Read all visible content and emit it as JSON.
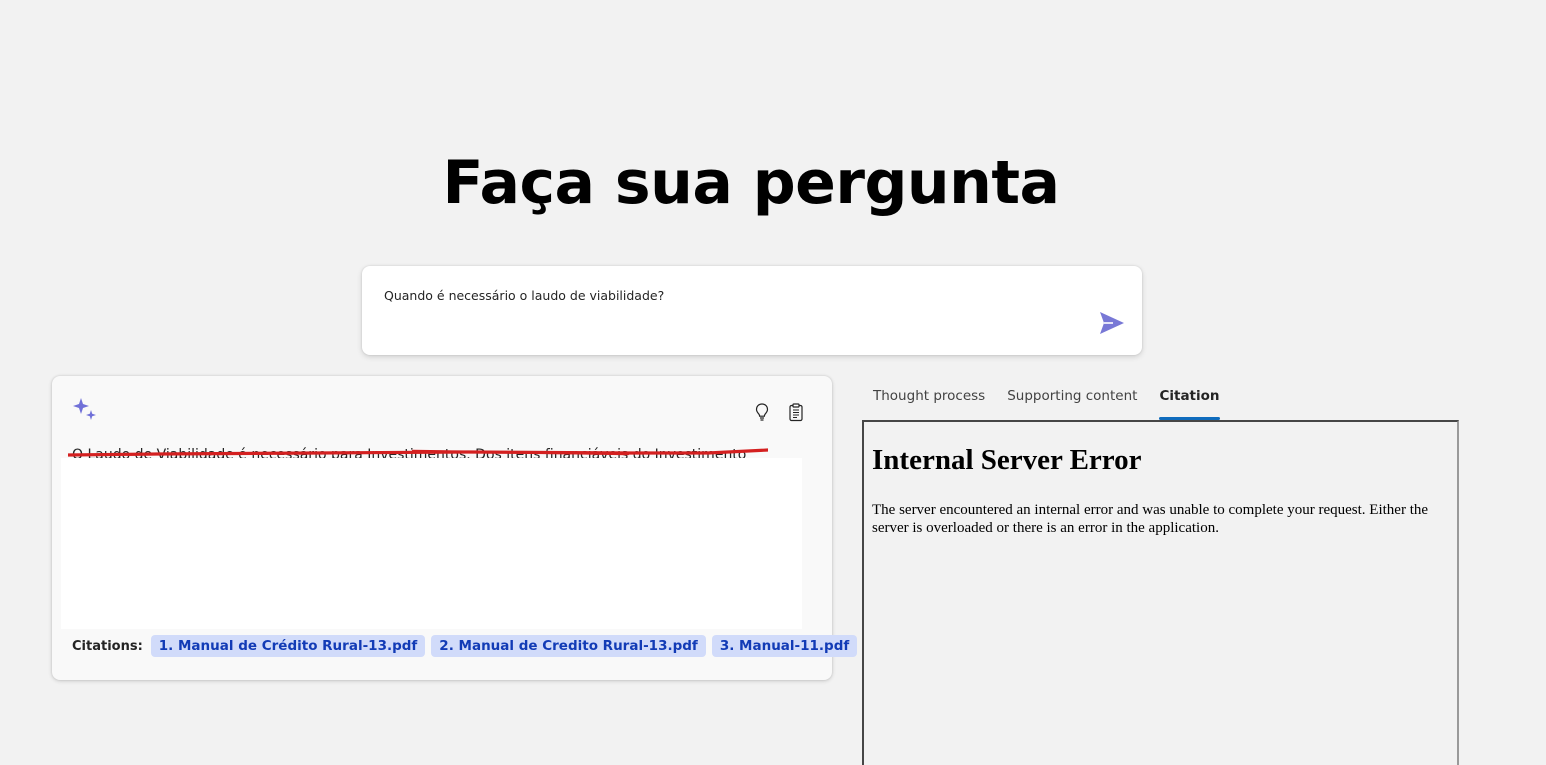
{
  "page": {
    "title": "Faça sua pergunta"
  },
  "question": {
    "value": "Quando é necessário o laudo de viabilidade?",
    "send_icon": "send-icon",
    "accent_color": "#7878d6"
  },
  "answer": {
    "text": "O Laudo de Viabilidade é necessário para Investimentos. Dos itens financiáveis do Investimento",
    "icons": {
      "sparkle": "sparkle-icon",
      "thought": "lightbulb-icon",
      "supporting": "clipboard-icon"
    },
    "citations_label": "Citations:",
    "citations": [
      "1. Manual de Crédito Rural-13.pdf",
      "2. Manual de Credito Rural-13.pdf",
      "3. Manual-11.pdf"
    ]
  },
  "panel": {
    "tabs": [
      "Thought process",
      "Supporting content",
      "Citation"
    ],
    "active_tab": "Citation",
    "error_title": "Internal Server Error",
    "error_body": "The server encountered an internal error and was unable to complete your request. Either the server is overloaded or there is an error in the application."
  },
  "colors": {
    "background": "#f2f2f2",
    "chip_background": "#d1dbfa",
    "chip_text": "#123bb6",
    "tab_indicator": "#0f6cbd",
    "redaction_red": "#d42020"
  }
}
